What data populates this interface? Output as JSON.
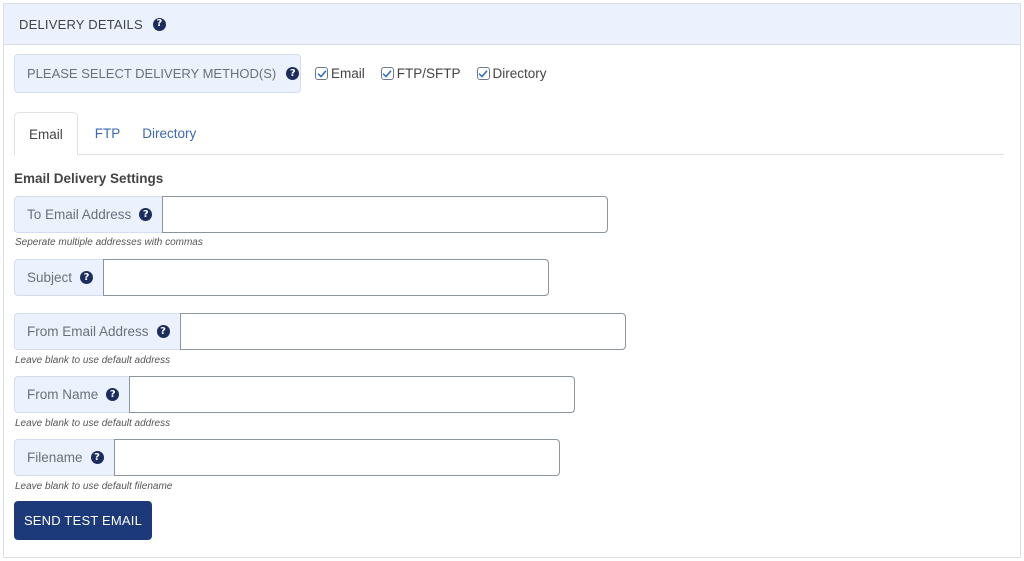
{
  "panel": {
    "title": "DELIVERY DETAILS",
    "help_icon": "question-circle-icon"
  },
  "delivery_methods": {
    "label": "PLEASE SELECT DELIVERY METHOD(S)",
    "options": [
      {
        "label": "Email",
        "checked": true
      },
      {
        "label": "FTP/SFTP",
        "checked": true
      },
      {
        "label": "Directory",
        "checked": true
      }
    ]
  },
  "tabs": [
    {
      "label": "Email",
      "active": true
    },
    {
      "label": "FTP",
      "active": false
    },
    {
      "label": "Directory",
      "active": false
    }
  ],
  "email_settings": {
    "title": "Email Delivery Settings",
    "fields": [
      {
        "label": "To Email Address",
        "value": "",
        "placeholder": "",
        "hint": "Seperate multiple addresses with commas"
      },
      {
        "label": "Subject",
        "value": "",
        "placeholder": "",
        "hint": ""
      },
      {
        "label": "From Email Address",
        "value": "",
        "placeholder": "",
        "hint": "Leave blank to use default address"
      },
      {
        "label": "From Name",
        "value": "",
        "placeholder": "",
        "hint": "Leave blank to use default address"
      },
      {
        "label": "Filename",
        "value": "",
        "placeholder": "",
        "hint": "Leave blank to use default filename"
      }
    ],
    "send_button": "SEND TEST EMAIL"
  },
  "colors": {
    "header_bg": "#ebf2fd",
    "primary_button": "#1c3a7a",
    "link": "#3b6ab5",
    "help_icon": "#1b2d5e"
  }
}
